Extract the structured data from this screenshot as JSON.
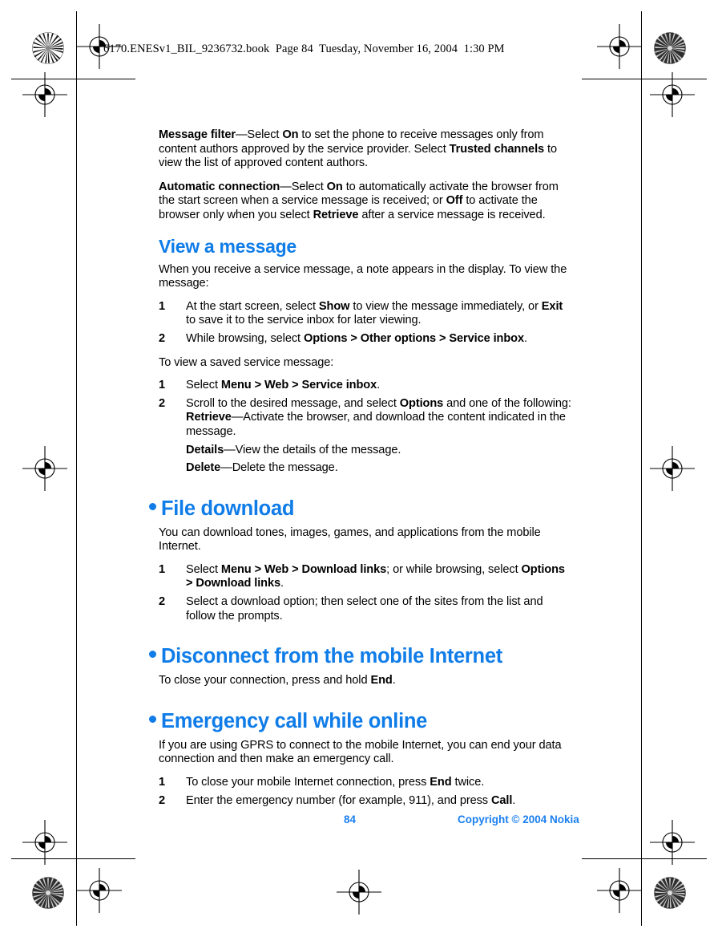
{
  "document": {
    "slugline": "6170.ENESv1_BIL_9236732.book  Page 84  Tuesday, November 16, 2004  1:30 PM",
    "accent_color": "#0f7ce8",
    "text_color": "#000000",
    "page_background": "#ffffff"
  },
  "body": {
    "message_filter": {
      "term": "Message filter",
      "dash": "—Select ",
      "bold1": "On",
      "text1": " to set the phone to receive messages only from content authors approved by the service provider. Select ",
      "bold2": "Trusted channels",
      "text2": " to view the list of approved content authors."
    },
    "automatic_connection": {
      "term": "Automatic connection",
      "dash": "—Select ",
      "bold1": "On",
      "text1": " to automatically activate the browser from the start screen when a service message is received; or ",
      "bold2": "Off",
      "text2": " to activate the browser only when you select ",
      "bold3": "Retrieve",
      "text3": " after a service message is received."
    },
    "view_a_message": {
      "heading": "View a message",
      "intro": "When you receive a service message, a note appears in the display. To view the message:",
      "steps": [
        {
          "num": "1",
          "t1": "At the start screen, select ",
          "b1": "Show",
          "t2": " to view the message immediately, or ",
          "b2": "Exit",
          "t3": " to save it to the service inbox for later viewing."
        },
        {
          "num": "2",
          "t1": "While browsing, select ",
          "b1": "Options > Other options > Service inbox",
          "t2": "."
        }
      ],
      "saved_intro": "To view a saved service message:",
      "saved_steps": [
        {
          "num": "1",
          "t1": "Select ",
          "b1": "Menu > Web > Service inbox",
          "t2": "."
        },
        {
          "num": "2",
          "t1": "Scroll to the desired message, and select ",
          "b1": "Options",
          "t2": " and one of the following:"
        }
      ],
      "options": [
        {
          "term": "Retrieve",
          "desc": "—Activate the browser, and download the content indicated in the message."
        },
        {
          "term": "Details",
          "desc": "—View the details of the message."
        },
        {
          "term": "Delete",
          "desc": "—Delete the message."
        }
      ]
    },
    "file_download": {
      "heading": "File download",
      "intro": "You can download tones, images, games, and applications from the mobile Internet.",
      "steps": [
        {
          "num": "1",
          "t1": "Select ",
          "b1": "Menu > Web > Download links",
          "t2": "; or while browsing, select ",
          "b2": "Options > Download links",
          "t3": "."
        },
        {
          "num": "2",
          "t1": "Select a download option; then select one of the sites from the list and follow the prompts."
        }
      ]
    },
    "disconnect": {
      "heading": "Disconnect from the mobile Internet",
      "t1": "To close your connection, press and hold ",
      "b1": "End",
      "t2": "."
    },
    "emergency_call": {
      "heading": "Emergency call while online",
      "intro": "If you are using GPRS to connect to the mobile Internet, you can end your data connection and then make an emergency call.",
      "steps": [
        {
          "num": "1",
          "t1": "To close your mobile Internet connection, press ",
          "b1": "End",
          "t2": " twice."
        },
        {
          "num": "2",
          "t1": "Enter the emergency number (for example, 911), and press ",
          "b1": "Call",
          "t2": "."
        }
      ]
    }
  },
  "footer": {
    "page_number": "84",
    "copyright": "Copyright © 2004 Nokia"
  }
}
